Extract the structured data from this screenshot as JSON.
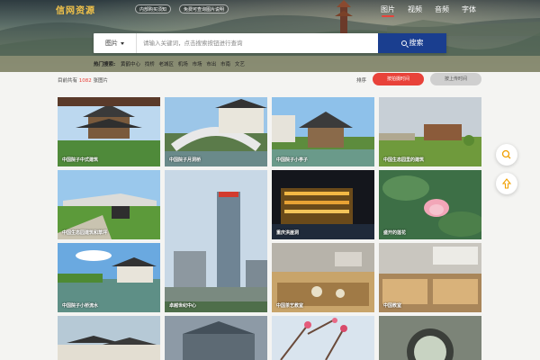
{
  "header": {
    "logo": "信网资源",
    "tags": [
      "内部购买须知",
      "免费可查询图片说明"
    ],
    "nav": [
      {
        "label": "图片",
        "active": true
      },
      {
        "label": "视频",
        "active": false
      },
      {
        "label": "音频",
        "active": false
      },
      {
        "label": "字体",
        "active": false
      }
    ]
  },
  "search": {
    "type_label": "图片",
    "placeholder": "请输入关键词，点击搜索按钮进行查询",
    "button_label": "搜索"
  },
  "hot": {
    "label": "热门搜索:",
    "keywords": [
      "黄鹤中心",
      "找桥",
      "老城区",
      "机场",
      "市场",
      "市出",
      "市南",
      "文艺"
    ]
  },
  "results": {
    "prefix": "目前共有",
    "count": "1082",
    "suffix": "张图片"
  },
  "sort": {
    "label": "排序",
    "options": [
      {
        "label": "按拍摄时间",
        "active": true
      },
      {
        "label": "按上传时间",
        "active": false
      }
    ]
  },
  "tiles": [
    {
      "caption": "中国院子中式建筑",
      "icon": "pavilion"
    },
    {
      "caption": "中国院子月洞桥",
      "icon": "bridge"
    },
    {
      "caption": "中国院子小亭子",
      "icon": "pavilion"
    },
    {
      "caption": "中国生态园里的建筑",
      "icon": "building"
    },
    {
      "caption": "中国生态园建筑和草坪",
      "icon": "building"
    },
    {
      "caption": "卓越世纪中心",
      "icon": "skyscraper"
    },
    {
      "caption": "重庆洪崖洞",
      "icon": "night-city"
    },
    {
      "caption": "盛开的莲花",
      "icon": "lotus"
    },
    {
      "caption": "中国院子小桥流水",
      "icon": "pavilion"
    },
    {
      "caption": "中国茶艺教室",
      "icon": "tearoom"
    },
    {
      "caption": "中国教室",
      "icon": "classroom"
    },
    {
      "caption": "",
      "icon": "village"
    },
    {
      "caption": "",
      "icon": "blossom"
    },
    {
      "caption": "",
      "icon": "moon-gate"
    }
  ],
  "float_buttons": [
    {
      "icon": "search-icon"
    },
    {
      "icon": "top-icon"
    }
  ],
  "colors": {
    "accent": "#e8423a",
    "brand": "#1a3e8f",
    "logo": "#f1c24a"
  }
}
